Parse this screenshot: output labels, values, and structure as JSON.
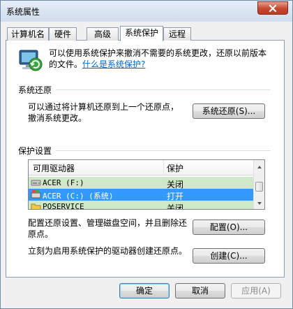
{
  "window": {
    "title": "系统属性",
    "close_symbol": "×"
  },
  "tabs": [
    {
      "label": "计算机名"
    },
    {
      "label": "硬件"
    },
    {
      "label": "高级"
    },
    {
      "label": "系统保护",
      "active": true
    },
    {
      "label": "远程"
    }
  ],
  "intro": {
    "text": "可以使用系统保护来撤消不需要的系统更改，还原以前版本的文件。",
    "link": "什么是系统保护?"
  },
  "system_restore": {
    "title": "系统还原",
    "description_line1": "可以通过将计算机还原到上一个还原点，",
    "description_line2": "撤消系统更改。",
    "button": "系统还原(S)..."
  },
  "protection": {
    "title": "保护设置",
    "columns": [
      "可用驱动器",
      "保护"
    ],
    "rows": [
      {
        "drive": "ACER (F:)",
        "status": "关闭",
        "icon": "drive-icon",
        "selected": false
      },
      {
        "drive": "ACER (C:) (系统)",
        "status": "打开",
        "icon": "system-drive-icon",
        "selected": true
      },
      {
        "drive": "PQSERVICE",
        "status": "关闭",
        "icon": "folder-drive-icon",
        "selected": false
      }
    ],
    "configure_text_line1": "配置还原设置、管理磁盘空间，并且删除还",
    "configure_text_line2": "原点。",
    "configure_button": "配置(O)...",
    "create_text": "立刻为启用系统保护的驱动器创建还原点。",
    "create_button": "创建(C)..."
  },
  "footer": {
    "ok": "确定",
    "cancel": "取消",
    "apply": "应用(A)"
  },
  "colors": {
    "selected_row": "#3399ff",
    "drive_row": "#cfe8c7",
    "link": "#0066cc"
  }
}
